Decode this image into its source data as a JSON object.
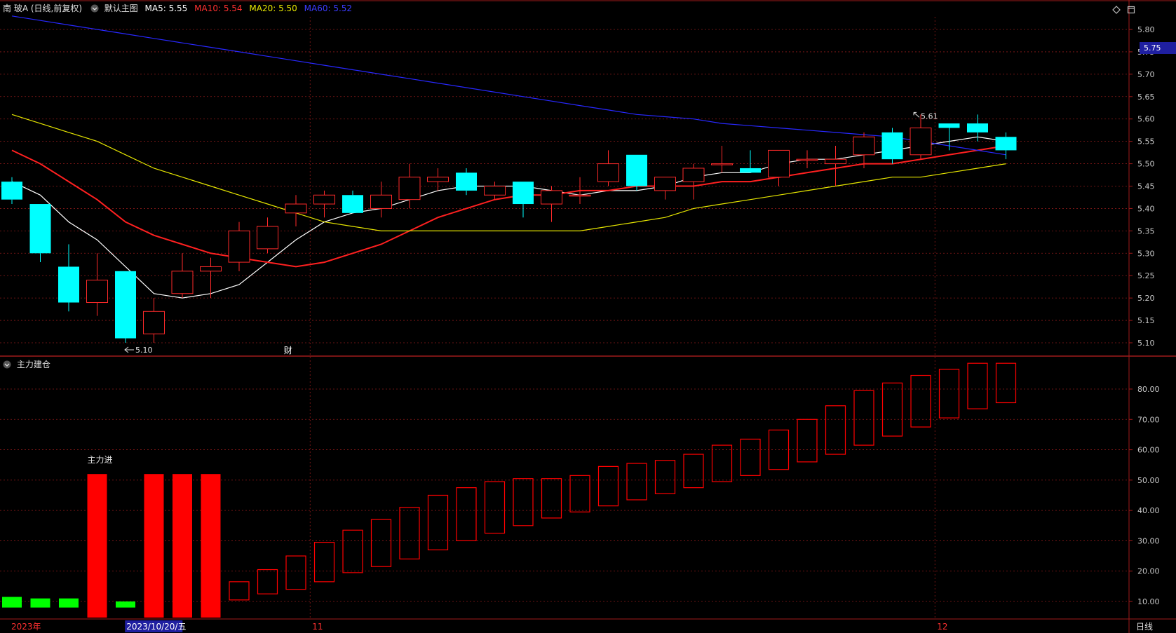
{
  "header": {
    "title": "南 玻A (日线,前复权)",
    "template": "默认主图",
    "ma5_label": "MA5: 5.55",
    "ma10_label": "MA10: 5.54",
    "ma20_label": "MA20: 5.50",
    "ma60_label": "MA60: 5.52"
  },
  "colors": {
    "up": "#ff2a2a",
    "down": "#00ffff",
    "ma5": "#ffffff",
    "ma10": "#ff2020",
    "ma20": "#e6e600",
    "ma60": "#2828ff",
    "grid": "#8b1a1a",
    "axis": "#c8c8c8",
    "highlight_bg": "#1f1fa0",
    "vol_green": "#00ff00",
    "vol_red": "#ff0000"
  },
  "sub_panel": {
    "title": "主力建仓",
    "annotation": "主力进"
  },
  "axis": {
    "bottom_labels": [
      {
        "label": "2023年",
        "index": 0.5
      },
      {
        "label": "11",
        "index": 11
      },
      {
        "label": "12",
        "index": 33
      }
    ],
    "crosshair_date": "2023/10/20/五",
    "crosshair_index": 4.5,
    "period_label": "日线",
    "marker_label": "财",
    "current_price_tag": "5.75"
  },
  "chart_data": [
    {
      "type": "candlestick",
      "title": "南 玻A (日线,前复权)",
      "ylim": [
        5.07,
        5.84
      ],
      "yticks": [
        "5.80",
        "5.75",
        "5.70",
        "5.65",
        "5.60",
        "5.55",
        "5.50",
        "5.45",
        "5.40",
        "5.35",
        "5.30",
        "5.25",
        "5.20",
        "5.15",
        "5.10"
      ],
      "annotations": [
        {
          "text": "5.10",
          "index": 4,
          "value": 5.1,
          "kind": "low"
        },
        {
          "text": "5.61",
          "index": 32,
          "value": 5.61,
          "kind": "high"
        }
      ],
      "candles": [
        {
          "o": 5.46,
          "h": 5.47,
          "l": 5.41,
          "c": 5.42
        },
        {
          "o": 5.41,
          "h": 5.41,
          "l": 5.28,
          "c": 5.3
        },
        {
          "o": 5.27,
          "h": 5.32,
          "l": 5.17,
          "c": 5.19
        },
        {
          "o": 5.19,
          "h": 5.3,
          "l": 5.16,
          "c": 5.24
        },
        {
          "o": 5.26,
          "h": 5.26,
          "l": 5.1,
          "c": 5.11
        },
        {
          "o": 5.12,
          "h": 5.2,
          "l": 5.1,
          "c": 5.17
        },
        {
          "o": 5.21,
          "h": 5.3,
          "l": 5.2,
          "c": 5.26
        },
        {
          "o": 5.26,
          "h": 5.29,
          "l": 5.2,
          "c": 5.27
        },
        {
          "o": 5.28,
          "h": 5.37,
          "l": 5.26,
          "c": 5.35
        },
        {
          "o": 5.31,
          "h": 5.38,
          "l": 5.3,
          "c": 5.36
        },
        {
          "o": 5.39,
          "h": 5.43,
          "l": 5.36,
          "c": 5.41
        },
        {
          "o": 5.41,
          "h": 5.44,
          "l": 5.38,
          "c": 5.43
        },
        {
          "o": 5.43,
          "h": 5.44,
          "l": 5.39,
          "c": 5.39
        },
        {
          "o": 5.4,
          "h": 5.46,
          "l": 5.38,
          "c": 5.43
        },
        {
          "o": 5.42,
          "h": 5.5,
          "l": 5.4,
          "c": 5.47
        },
        {
          "o": 5.46,
          "h": 5.49,
          "l": 5.44,
          "c": 5.47
        },
        {
          "o": 5.48,
          "h": 5.49,
          "l": 5.43,
          "c": 5.44
        },
        {
          "o": 5.43,
          "h": 5.46,
          "l": 5.42,
          "c": 5.45
        },
        {
          "o": 5.46,
          "h": 5.46,
          "l": 5.38,
          "c": 5.41
        },
        {
          "o": 5.41,
          "h": 5.45,
          "l": 5.37,
          "c": 5.44
        },
        {
          "o": 5.43,
          "h": 5.47,
          "l": 5.41,
          "c": 5.43
        },
        {
          "o": 5.46,
          "h": 5.53,
          "l": 5.45,
          "c": 5.5
        },
        {
          "o": 5.52,
          "h": 5.52,
          "l": 5.44,
          "c": 5.45
        },
        {
          "o": 5.44,
          "h": 5.47,
          "l": 5.42,
          "c": 5.47
        },
        {
          "o": 5.46,
          "h": 5.5,
          "l": 5.42,
          "c": 5.49
        },
        {
          "o": 5.5,
          "h": 5.54,
          "l": 5.48,
          "c": 5.5
        },
        {
          "o": 5.49,
          "h": 5.53,
          "l": 5.48,
          "c": 5.48
        },
        {
          "o": 5.47,
          "h": 5.53,
          "l": 5.45,
          "c": 5.53
        },
        {
          "o": 5.51,
          "h": 5.53,
          "l": 5.49,
          "c": 5.51
        },
        {
          "o": 5.5,
          "h": 5.54,
          "l": 5.45,
          "c": 5.51
        },
        {
          "o": 5.52,
          "h": 5.57,
          "l": 5.49,
          "c": 5.56
        },
        {
          "o": 5.57,
          "h": 5.58,
          "l": 5.5,
          "c": 5.51
        },
        {
          "o": 5.52,
          "h": 5.61,
          "l": 5.51,
          "c": 5.58
        },
        {
          "o": 5.59,
          "h": 5.59,
          "l": 5.53,
          "c": 5.58
        },
        {
          "o": 5.59,
          "h": 5.61,
          "l": 5.55,
          "c": 5.57
        },
        {
          "o": 5.56,
          "h": 5.57,
          "l": 5.51,
          "c": 5.53
        }
      ],
      "ma": [
        {
          "name": "MA5",
          "color": "#ffffff",
          "values": [
            5.46,
            5.43,
            5.37,
            5.33,
            5.27,
            5.21,
            5.2,
            5.21,
            5.23,
            5.28,
            5.33,
            5.37,
            5.39,
            5.4,
            5.42,
            5.44,
            5.45,
            5.45,
            5.45,
            5.44,
            5.43,
            5.44,
            5.44,
            5.45,
            5.47,
            5.48,
            5.48,
            5.5,
            5.51,
            5.51,
            5.52,
            5.53,
            5.54,
            5.55,
            5.56,
            5.55
          ]
        },
        {
          "name": "MA10",
          "color": "#ff2020",
          "values": [
            5.53,
            5.5,
            5.46,
            5.42,
            5.37,
            5.34,
            5.32,
            5.3,
            5.29,
            5.28,
            5.27,
            5.28,
            5.3,
            5.32,
            5.35,
            5.38,
            5.4,
            5.42,
            5.43,
            5.43,
            5.44,
            5.44,
            5.45,
            5.45,
            5.45,
            5.46,
            5.46,
            5.47,
            5.48,
            5.49,
            5.5,
            5.5,
            5.51,
            5.52,
            5.53,
            5.54
          ]
        },
        {
          "name": "MA20",
          "color": "#e6e600",
          "values": [
            5.61,
            5.59,
            5.57,
            5.55,
            5.52,
            5.49,
            5.47,
            5.45,
            5.43,
            5.41,
            5.39,
            5.37,
            5.36,
            5.35,
            5.35,
            5.35,
            5.35,
            5.35,
            5.35,
            5.35,
            5.35,
            5.36,
            5.37,
            5.38,
            5.4,
            5.41,
            5.42,
            5.43,
            5.44,
            5.45,
            5.46,
            5.47,
            5.47,
            5.48,
            5.49,
            5.5
          ]
        },
        {
          "name": "MA60",
          "color": "#2828ff",
          "values": [
            5.83,
            5.82,
            5.81,
            5.8,
            5.79,
            5.78,
            5.77,
            5.76,
            5.75,
            5.74,
            5.73,
            5.72,
            5.71,
            5.7,
            5.69,
            5.68,
            5.67,
            5.66,
            5.65,
            5.64,
            5.63,
            5.62,
            5.61,
            5.605,
            5.6,
            5.59,
            5.585,
            5.58,
            5.575,
            5.57,
            5.565,
            5.56,
            5.55,
            5.54,
            5.53,
            5.52
          ]
        }
      ]
    },
    {
      "type": "bar",
      "title": "主力建仓",
      "ylim": [
        0,
        90
      ],
      "yticks": [
        "80.00",
        "70.00",
        "60.00",
        "50.00",
        "40.00",
        "30.00",
        "20.00",
        "10.00"
      ],
      "bars": [
        {
          "kind": "solid-green",
          "low": 8,
          "high": 11.5
        },
        {
          "kind": "solid-green",
          "low": 8,
          "high": 11
        },
        {
          "kind": "solid-green",
          "low": 8,
          "high": 11
        },
        {
          "kind": "solid-red",
          "low": 0,
          "high": 52
        },
        {
          "kind": "solid-green",
          "low": 8,
          "high": 10
        },
        {
          "kind": "solid-red",
          "low": 0,
          "high": 52
        },
        {
          "kind": "solid-red",
          "low": 0,
          "high": 52
        },
        {
          "kind": "solid-red",
          "low": 0,
          "high": 52
        },
        {
          "kind": "hollow-red",
          "low": 10.5,
          "high": 16.5
        },
        {
          "kind": "hollow-red",
          "low": 12.5,
          "high": 20.5
        },
        {
          "kind": "hollow-red",
          "low": 14,
          "high": 25
        },
        {
          "kind": "hollow-red",
          "low": 16.5,
          "high": 29.5
        },
        {
          "kind": "hollow-red",
          "low": 19.5,
          "high": 33.5
        },
        {
          "kind": "hollow-red",
          "low": 21.5,
          "high": 37
        },
        {
          "kind": "hollow-red",
          "low": 24,
          "high": 41
        },
        {
          "kind": "hollow-red",
          "low": 27,
          "high": 45
        },
        {
          "kind": "hollow-red",
          "low": 30,
          "high": 47.5
        },
        {
          "kind": "hollow-red",
          "low": 32.5,
          "high": 49.5
        },
        {
          "kind": "hollow-red",
          "low": 35,
          "high": 50.5
        },
        {
          "kind": "hollow-red",
          "low": 37.5,
          "high": 50.5
        },
        {
          "kind": "hollow-red",
          "low": 39.5,
          "high": 51.5
        },
        {
          "kind": "hollow-red",
          "low": 41.5,
          "high": 54.5
        },
        {
          "kind": "hollow-red",
          "low": 43.5,
          "high": 55.5
        },
        {
          "kind": "hollow-red",
          "low": 45.5,
          "high": 56.5
        },
        {
          "kind": "hollow-red",
          "low": 47.5,
          "high": 58.5
        },
        {
          "kind": "hollow-red",
          "low": 49.5,
          "high": 61.5
        },
        {
          "kind": "hollow-red",
          "low": 51.5,
          "high": 63.5
        },
        {
          "kind": "hollow-red",
          "low": 53.5,
          "high": 66.5
        },
        {
          "kind": "hollow-red",
          "low": 56,
          "high": 70
        },
        {
          "kind": "hollow-red",
          "low": 58.5,
          "high": 74.5
        },
        {
          "kind": "hollow-red",
          "low": 61.5,
          "high": 79.5
        },
        {
          "kind": "hollow-red",
          "low": 64.5,
          "high": 82
        },
        {
          "kind": "hollow-red",
          "low": 67.5,
          "high": 84.5
        },
        {
          "kind": "hollow-red",
          "low": 70.5,
          "high": 86.5
        },
        {
          "kind": "hollow-red",
          "low": 73.5,
          "high": 88.5
        },
        {
          "kind": "hollow-red",
          "low": 75.5,
          "high": 88.5
        }
      ]
    }
  ]
}
